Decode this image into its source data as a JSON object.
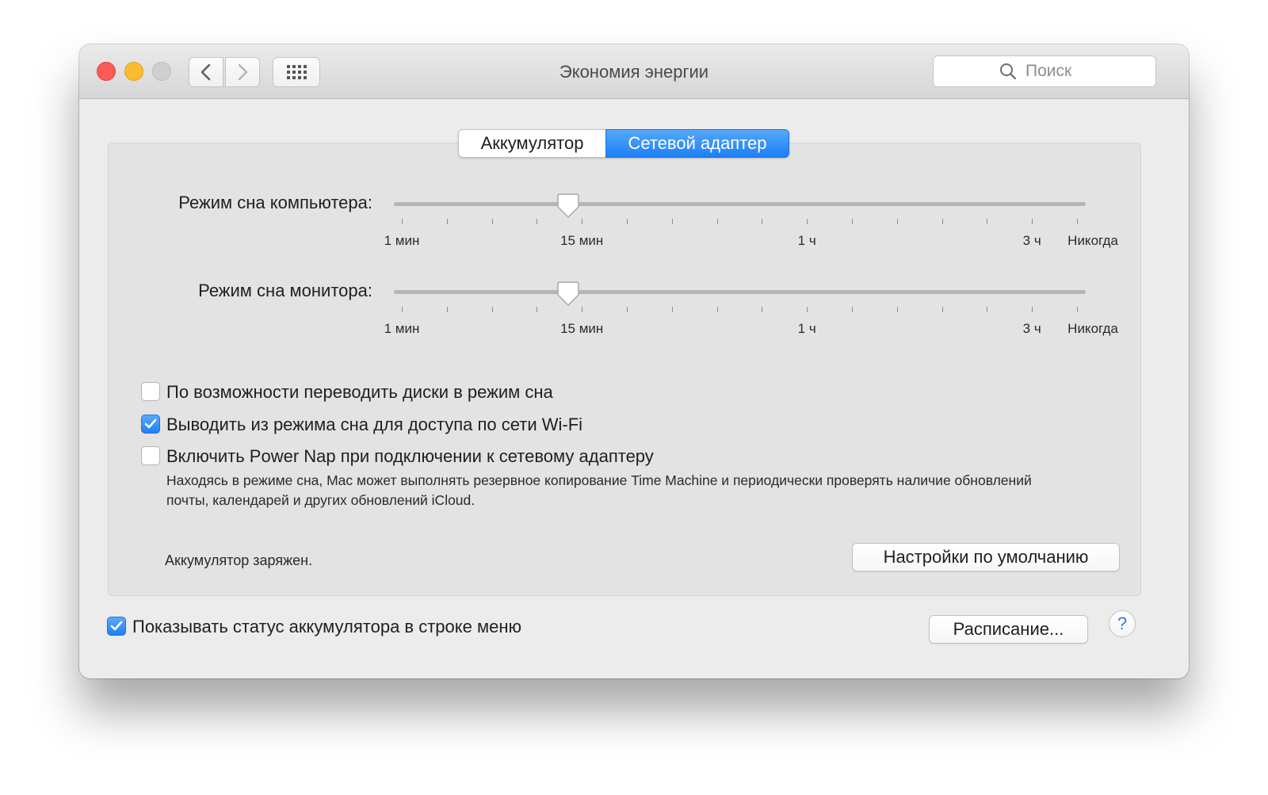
{
  "window": {
    "title": "Экономия энергии"
  },
  "search": {
    "placeholder": "Поиск"
  },
  "tabs": [
    {
      "label": "Аккумулятор",
      "selected": false
    },
    {
      "label": "Сетевой адаптер",
      "selected": true
    }
  ],
  "computer_sleep": {
    "label": "Режим сна компьютера:",
    "value": "15 мин",
    "ticks": [
      "1 мин",
      "15 мин",
      "1 ч",
      "3 ч",
      "Никогда"
    ]
  },
  "display_sleep": {
    "label": "Режим сна монитора:",
    "value": "15 мин",
    "ticks": [
      "1 мин",
      "15 мин",
      "1 ч",
      "3 ч",
      "Никогда"
    ]
  },
  "options": [
    {
      "label": "По возможности переводить диски в режим сна",
      "checked": false
    },
    {
      "label": "Выводить из режима сна для доступа по сети Wi-Fi",
      "checked": true
    },
    {
      "label": "Включить Power Nap при подключении к сетевому адаптеру",
      "checked": false
    }
  ],
  "power_nap_description": "Находясь в режиме сна, Mac может выполнять резервное копирование Time Machine и периодически проверять наличие обновлений почты, календарей и других обновлений iCloud.",
  "battery_status": "Аккумулятор заряжен.",
  "buttons": {
    "restore_defaults": "Настройки по умолчанию",
    "schedule": "Расписание...",
    "help": "?"
  },
  "show_battery_status": {
    "label": "Показывать статус аккумулятора в строке меню",
    "checked": true
  },
  "colors": {
    "accent": "#1d7ff5",
    "close": "#fc5b57",
    "minimize": "#fdbc2f",
    "zoom_disabled": "#cfcfcf"
  }
}
